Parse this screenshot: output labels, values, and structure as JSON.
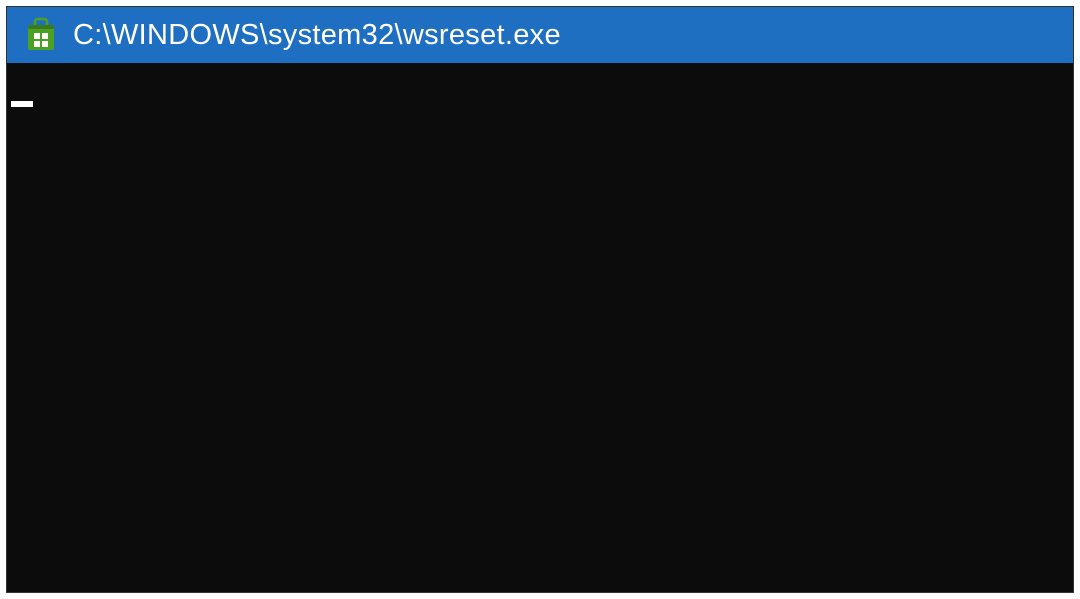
{
  "window": {
    "title": "C:\\WINDOWS\\system32\\wsreset.exe",
    "icon_name": "microsoft-store-icon"
  },
  "terminal": {
    "content": ""
  },
  "colors": {
    "titlebar_bg": "#1e6fc1",
    "terminal_bg": "#0c0c0c",
    "icon_green": "#4ca123",
    "icon_dark_green": "#3a7a1a"
  }
}
